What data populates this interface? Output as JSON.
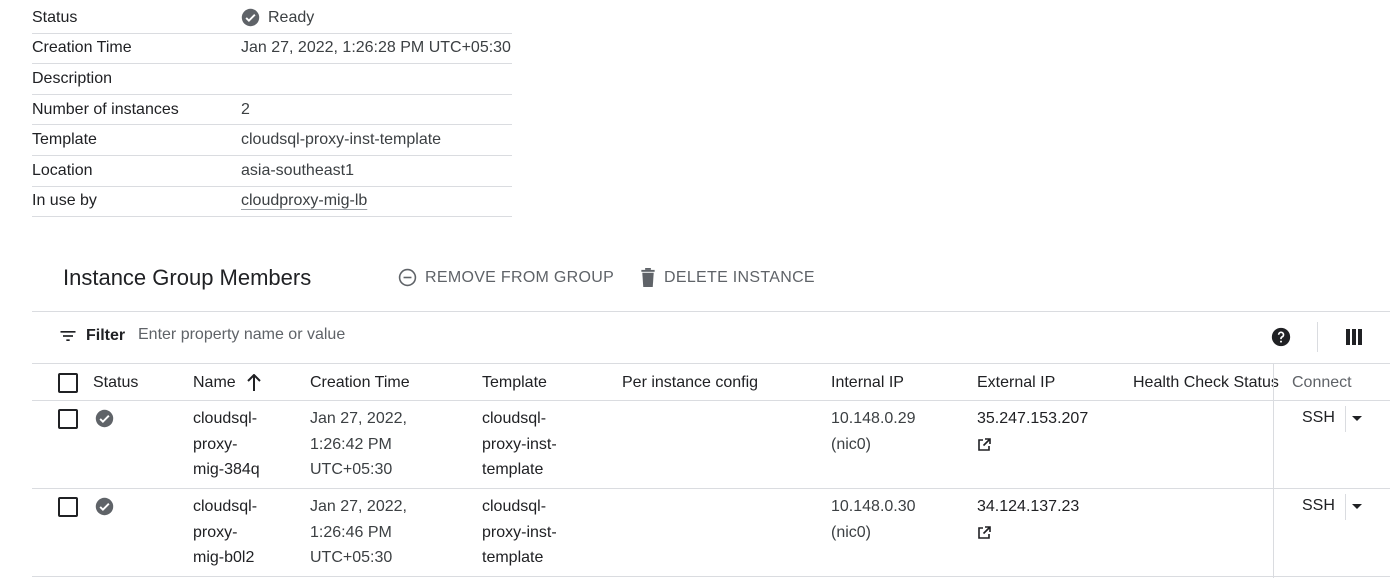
{
  "details": [
    {
      "label": "Status",
      "value": "Ready",
      "icon": "check-circle-icon"
    },
    {
      "label": "Creation Time",
      "value": "Jan 27, 2022, 1:26:28 PM UTC+05:30"
    },
    {
      "label": "Description",
      "value": ""
    },
    {
      "label": "Number of instances",
      "value": "2"
    },
    {
      "label": "Template",
      "value": "cloudsql-proxy-inst-template"
    },
    {
      "label": "Location",
      "value": "asia-southeast1"
    },
    {
      "label": "In use by",
      "value": "cloudproxy-mig-lb",
      "link": true
    }
  ],
  "members": {
    "title": "Instance Group Members",
    "actions": {
      "remove": {
        "label": "REMOVE FROM GROUP",
        "icon": "remove-circle-icon"
      },
      "delete": {
        "label": "DELETE INSTANCE",
        "icon": "trash-icon"
      }
    },
    "filter": {
      "label": "Filter",
      "placeholder": "Enter property name or value",
      "icon": "filter-icon"
    },
    "toolbar_icons": [
      "help-icon",
      "column-display-icon"
    ],
    "columns": {
      "status": "Status",
      "name": "Name",
      "creation_time": "Creation Time",
      "template": "Template",
      "per_instance_config": "Per instance config",
      "internal_ip": "Internal IP",
      "external_ip": "External IP",
      "health_check_status": "Health Check Status",
      "connect": "Connect"
    },
    "sort": {
      "column": "Name",
      "direction": "ascending",
      "icon": "arrow-up-icon"
    },
    "rows": [
      {
        "status_icon": "check-circle-icon",
        "name": [
          "cloudsql-",
          "proxy-",
          "mig-384q"
        ],
        "creation_time": [
          "Jan 27, 2022,",
          "1:26:42 PM",
          "UTC+05:30"
        ],
        "template": [
          "cloudsql-",
          "proxy-inst-",
          "template"
        ],
        "per_instance_config": "",
        "internal_ip": [
          "10.148.0.29",
          "(nic0)"
        ],
        "external_ip": "35.247.153.207",
        "health_check_status": "",
        "connect": "SSH"
      },
      {
        "status_icon": "check-circle-icon",
        "name": [
          "cloudsql-",
          "proxy-",
          "mig-b0l2"
        ],
        "creation_time": [
          "Jan 27, 2022,",
          "1:26:46 PM",
          "UTC+05:30"
        ],
        "template": [
          "cloudsql-",
          "proxy-inst-",
          "template"
        ],
        "per_instance_config": "",
        "internal_ip": [
          "10.148.0.30",
          "(nic0)"
        ],
        "external_ip": "34.124.137.23",
        "health_check_status": "",
        "connect": "SSH"
      }
    ]
  }
}
